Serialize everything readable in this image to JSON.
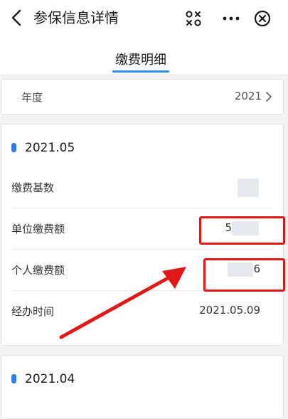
{
  "nav": {
    "title": "参保信息详情"
  },
  "tabs": {
    "active_label": "缴费明细"
  },
  "year_filter": {
    "label": "年度",
    "value": "2021"
  },
  "records": [
    {
      "month": "2021.05",
      "fields": [
        {
          "label": "缴费基数",
          "value": ""
        },
        {
          "label": "单位缴费额",
          "value": "5"
        },
        {
          "label": "个人缴费额",
          "value": "6"
        },
        {
          "label": "经办时间",
          "value": "2021.05.09"
        }
      ]
    },
    {
      "month": "2021.04"
    }
  ],
  "colors": {
    "accent": "#2f8fe8",
    "annotation_red": "#e01818"
  },
  "icons": {
    "back": "chevron-left-icon",
    "scan": "scan-icon",
    "more": "more-icon",
    "close": "close-circle-icon"
  }
}
